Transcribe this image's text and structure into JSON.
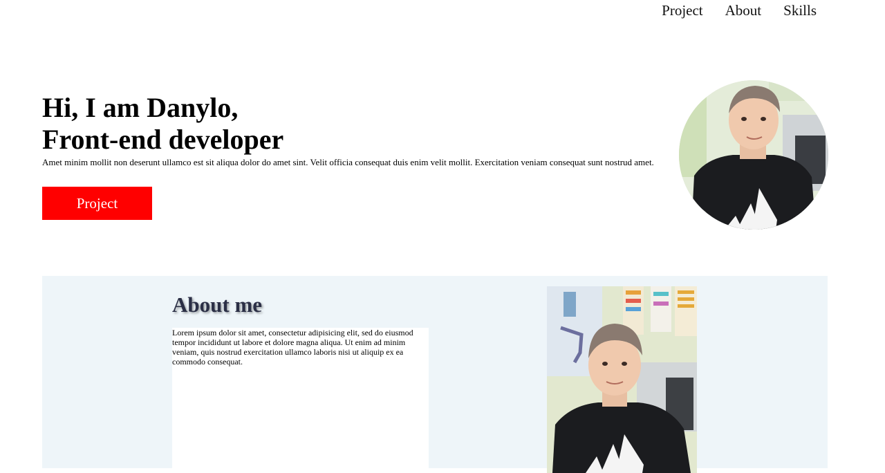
{
  "nav": {
    "items": [
      "Project",
      "About",
      "Skills"
    ]
  },
  "hero": {
    "title_line1": "Hi, I am Danylo,",
    "title_line2": "Front-end developer",
    "description": "Amet minim mollit non deserunt ullamco est sit aliqua dolor do amet sint. Velit officia consequat duis enim velit mollit. Exercitation veniam consequat sunt nostrud amet.",
    "button_label": "Project"
  },
  "about": {
    "title": "About me",
    "text": "Lorem ipsum dolor sit amet, consectetur adipisicing elit, sed do eiusmod tempor incididunt ut labore et dolore magna aliqua. Ut enim ad minim veniam, quis nostrud exercitation ullamco laboris nisi ut aliquip ex ea commodo consequat."
  },
  "colors": {
    "button_bg": "#ff0000",
    "about_bg": "#eef5f9",
    "about_title": "#2b2f46"
  }
}
